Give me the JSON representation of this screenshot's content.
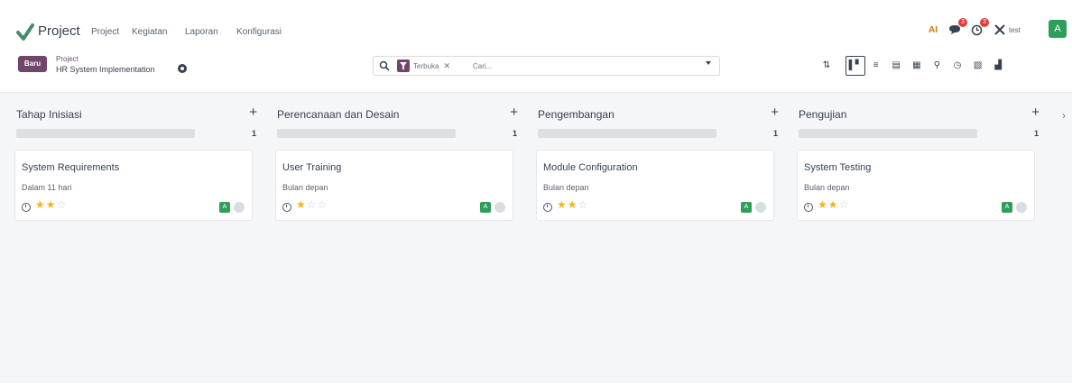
{
  "app": {
    "name": "Project",
    "brand_color": "#71466b"
  },
  "nav": [
    {
      "label": "Project"
    },
    {
      "label": "Kegiatan"
    },
    {
      "label": "Laporan"
    },
    {
      "label": "Konfigurasi"
    }
  ],
  "systray": {
    "ai_label": "AI",
    "discuss_badge": "3",
    "activity_badge": "3",
    "company": "test",
    "avatar_letter": "A"
  },
  "control": {
    "new_button": "Baru",
    "breadcrumb_parent": "Project",
    "breadcrumb_current": "HR System Implementation",
    "search": {
      "facet": "Terbuka",
      "placeholder": "Cari..."
    }
  },
  "view_switcher": [
    {
      "name": "kanban",
      "glyph": "▌▘",
      "active": true
    },
    {
      "name": "list",
      "glyph": "≡"
    },
    {
      "name": "form",
      "glyph": "▤"
    },
    {
      "name": "calendar",
      "glyph": "▦"
    },
    {
      "name": "map",
      "glyph": "⚲"
    },
    {
      "name": "activity",
      "glyph": "◷"
    },
    {
      "name": "pivot",
      "glyph": "▧"
    },
    {
      "name": "graph",
      "glyph": "▟"
    }
  ],
  "columns": [
    {
      "title": "Tahap Inisiasi",
      "count": "1",
      "card": {
        "title": "System Requirements",
        "deadline": "Dalam 11 hari",
        "stars": 2,
        "avatar": "A"
      }
    },
    {
      "title": "Perencanaan dan Desain",
      "count": "1",
      "card": {
        "title": "User Training",
        "deadline": "Bulan depan",
        "stars": 1,
        "avatar": "A"
      }
    },
    {
      "title": "Pengembangan",
      "count": "1",
      "card": {
        "title": "Module Configuration",
        "deadline": "Bulan depan",
        "stars": 2,
        "avatar": "A"
      }
    },
    {
      "title": "Pengujian",
      "count": "1",
      "card": {
        "title": "System Testing",
        "deadline": "Bulan depan",
        "stars": 2,
        "avatar": "A"
      }
    }
  ]
}
